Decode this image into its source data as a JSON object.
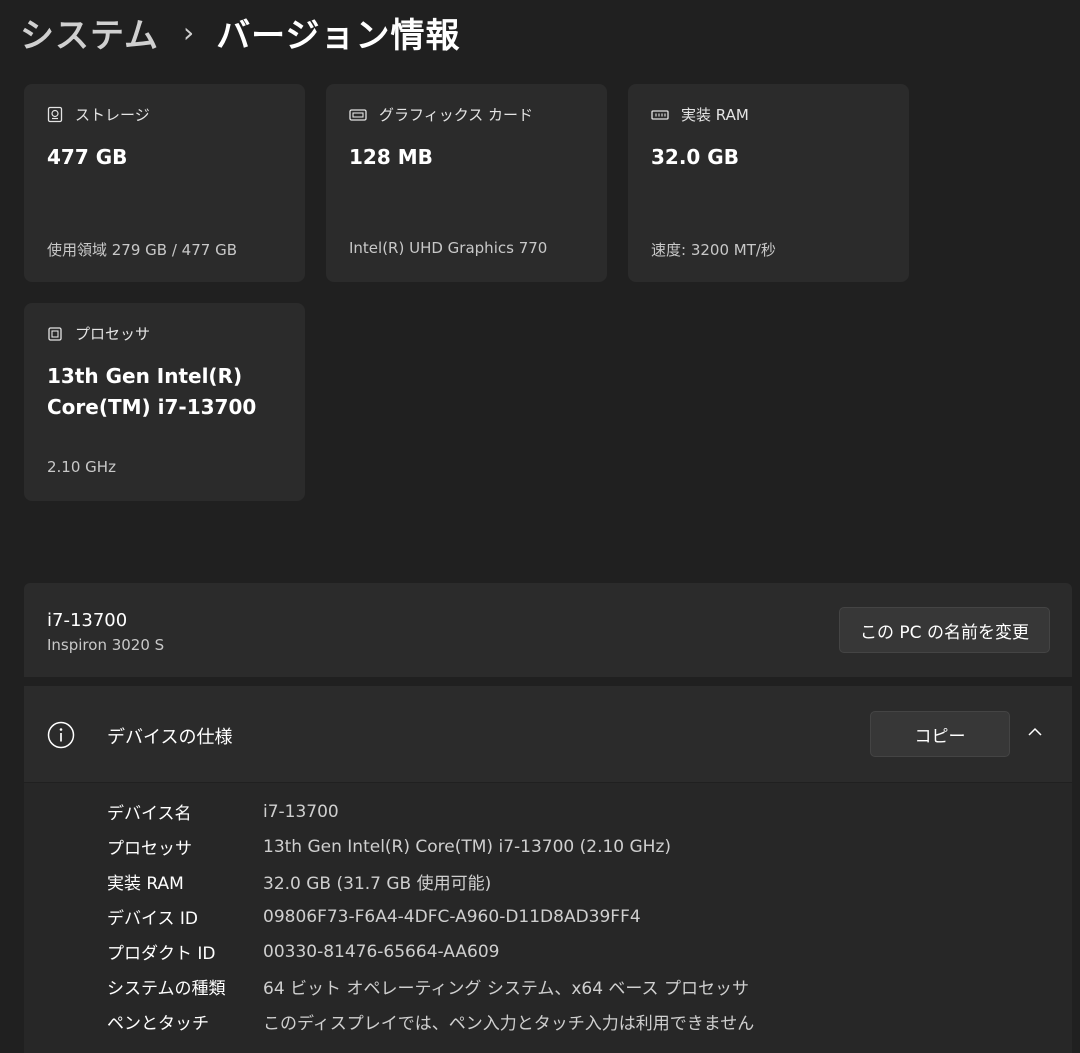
{
  "breadcrumb": {
    "parent": "システム",
    "separator": "›",
    "current": "バージョン情報"
  },
  "cards": {
    "storage": {
      "label": "ストレージ",
      "value": "477 GB",
      "detail": "使用領域 279 GB / 477 GB"
    },
    "gpu": {
      "label": "グラフィックス カード",
      "value": "128 MB",
      "detail": "Intel(R) UHD Graphics 770"
    },
    "ram": {
      "label": "実装 RAM",
      "value": "32.0 GB",
      "detail": "速度: 3200 MT/秒"
    },
    "cpu": {
      "label": "プロセッサ",
      "value_line1": "13th Gen Intel(R)",
      "value_line2": "Core(TM) i7-13700",
      "detail": "2.10 GHz"
    }
  },
  "device": {
    "pc_name": "i7-13700",
    "model": "Inspiron 3020 S",
    "rename_label": "この PC の名前を変更"
  },
  "specs": {
    "title": "デバイスの仕様",
    "copy_label": "コピー",
    "rows": [
      {
        "key": "デバイス名",
        "value": "i7-13700"
      },
      {
        "key": "プロセッサ",
        "value": "13th Gen Intel(R) Core(TM) i7-13700 (2.10 GHz)"
      },
      {
        "key": "実装 RAM",
        "value": "32.0 GB (31.7 GB 使用可能)"
      },
      {
        "key": "デバイス ID",
        "value": "09806F73-F6A4-4DFC-A960-D11D8AD39FF4"
      },
      {
        "key": "プロダクト ID",
        "value": "00330-81476-65664-AA609"
      },
      {
        "key": "システムの種類",
        "value": "64 ビット オペレーティング システム、x64 ベース プロセッサ"
      },
      {
        "key": "ペンとタッチ",
        "value": "このディスプレイでは、ペン入力とタッチ入力は利用できません"
      }
    ]
  },
  "icons": {
    "storage": "hard-drive-icon",
    "gpu": "graphics-card-icon",
    "ram": "memory-icon",
    "cpu": "processor-icon",
    "info": "info-icon",
    "collapse": "chevron-up-icon"
  }
}
